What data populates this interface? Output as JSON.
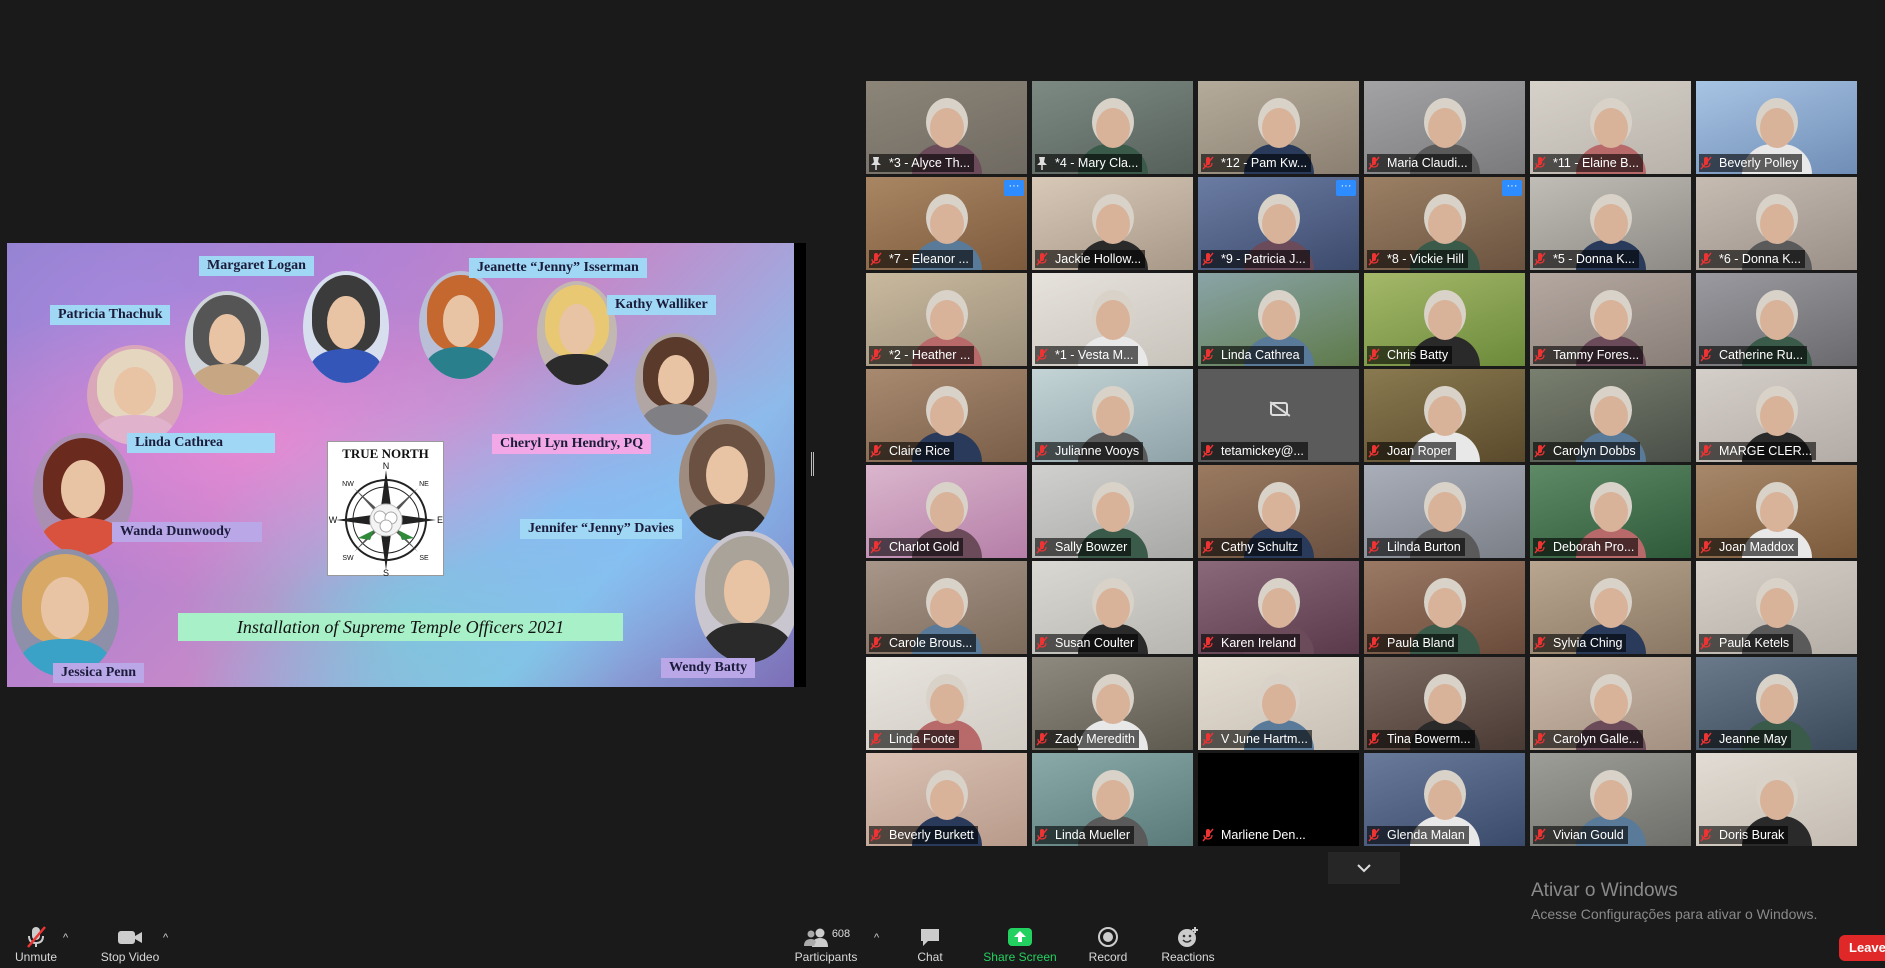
{
  "slide": {
    "names": {
      "margaret": "Margaret Logan",
      "jeanette": "Jeanette “Jenny” Isserman",
      "patricia": "Patricia Thachuk",
      "kathy": "Kathy Walliker",
      "linda": "Linda Cathrea",
      "cheryl": "Cheryl Lyn Hendry, PQ",
      "wanda": "Wanda Dunwoody",
      "jennifer": "Jennifer “Jenny” Davies",
      "jessica": "Jessica Penn",
      "wendy": "Wendy Batty"
    },
    "compass_title": "TRUE NORTH",
    "compass_directions": [
      "N",
      "E",
      "S",
      "W",
      "NE",
      "NW",
      "SE",
      "SW"
    ],
    "banner": "Installation of Supreme Temple Officers 2021"
  },
  "gallery": {
    "participants": [
      {
        "name": "*3 - Alyce Th...",
        "active": true,
        "pinned": true
      },
      {
        "name": "*4 - Mary Cla...",
        "pinned": true
      },
      {
        "name": "*12 - Pam Kw..."
      },
      {
        "name": "Maria Claudi..."
      },
      {
        "name": "*11 - Elaine B..."
      },
      {
        "name": "Beverly Polley"
      },
      {
        "name": "*7 - Eleanor ...",
        "more": true
      },
      {
        "name": "Jackie Hollow..."
      },
      {
        "name": "*9 - Patricia J...",
        "more": true
      },
      {
        "name": "*8 - Vickie Hill",
        "more": true
      },
      {
        "name": "*5 - Donna K..."
      },
      {
        "name": "*6 - Donna K..."
      },
      {
        "name": "*2 - Heather ..."
      },
      {
        "name": "*1 - Vesta M..."
      },
      {
        "name": "Linda Cathrea"
      },
      {
        "name": "Chris Batty"
      },
      {
        "name": "Tammy Fores..."
      },
      {
        "name": "Catherine Ru..."
      },
      {
        "name": "Claire Rice"
      },
      {
        "name": "Julianne Vooys"
      },
      {
        "name": "tetamickey@...",
        "camoff": true
      },
      {
        "name": "Joan Roper"
      },
      {
        "name": "Carolyn Dobbs"
      },
      {
        "name": "MARGE CLER..."
      },
      {
        "name": "Charlot Gold"
      },
      {
        "name": "Sally Bowzer"
      },
      {
        "name": "Cathy Schultz"
      },
      {
        "name": "Lilnda Burton"
      },
      {
        "name": "Deborah Pro..."
      },
      {
        "name": "Joan Maddox"
      },
      {
        "name": "Carole Brous..."
      },
      {
        "name": "Susan Coulter"
      },
      {
        "name": "Karen Ireland"
      },
      {
        "name": "Paula Bland"
      },
      {
        "name": "Sylvia Ching"
      },
      {
        "name": "Paula Ketels"
      },
      {
        "name": "Linda Foote"
      },
      {
        "name": "Zady Meredith"
      },
      {
        "name": "V June Hartm..."
      },
      {
        "name": "Tina Bowerm..."
      },
      {
        "name": "Carolyn Galle..."
      },
      {
        "name": "Jeanne May"
      },
      {
        "name": "Beverly Burkett"
      },
      {
        "name": "Linda Mueller"
      },
      {
        "name": "Marliene Den...",
        "black": true
      },
      {
        "name": "Glenda Malan"
      },
      {
        "name": "Vivian Gould"
      },
      {
        "name": "Doris Burak"
      }
    ],
    "more_glyph": "···"
  },
  "watermark": {
    "title": "Ativar o Windows",
    "subtitle": "Acesse Configurações para ativar o Windows."
  },
  "toolbar": {
    "unmute": "Unmute",
    "stop_video": "Stop Video",
    "participants": "Participants",
    "participants_count": "608",
    "chat": "Chat",
    "share_screen": "Share Screen",
    "record": "Record",
    "reactions": "Reactions",
    "leave": "Leave",
    "caret": "^",
    "share_green": "#23d160",
    "leave_red": "#e02828"
  }
}
